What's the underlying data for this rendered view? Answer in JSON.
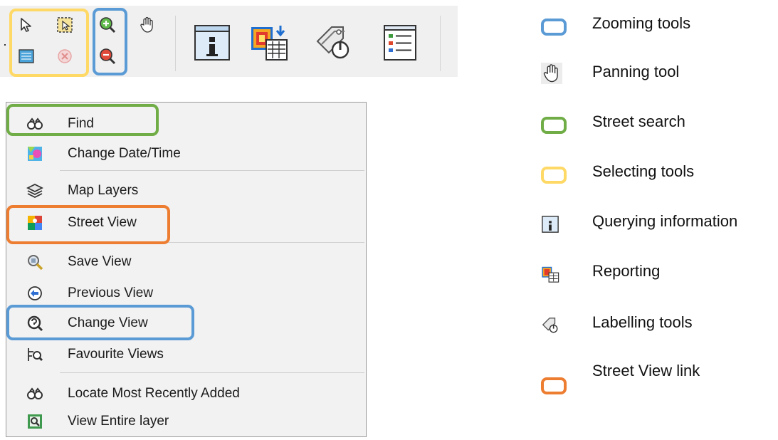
{
  "menu": {
    "items": [
      {
        "label": "Find",
        "icon": "binoculars-icon"
      },
      {
        "label": "Change Date/Time",
        "icon": "date-time-map-icon"
      },
      {
        "label": "Map Layers",
        "icon": "layers-icon"
      },
      {
        "label": "Street View",
        "icon": "street-view-icon"
      },
      {
        "label": "Save View",
        "icon": "magnifier-save-icon"
      },
      {
        "label": "Previous View",
        "icon": "back-arrow-circle-icon"
      },
      {
        "label": "Change View",
        "icon": "change-view-magnifier-icon"
      },
      {
        "label": "Favourite Views",
        "icon": "favourite-views-icon"
      },
      {
        "label": "Locate Most Recently Added",
        "icon": "binoculars-icon"
      },
      {
        "label": "View Entire layer",
        "icon": "view-entire-layer-icon"
      }
    ]
  },
  "legend": [
    {
      "label": "Zooming tools",
      "swatch_color": "#5b9bd5"
    },
    {
      "label": "Panning tool",
      "icon": "pan-hand-icon"
    },
    {
      "label": "Street search",
      "swatch_color": "#70ad47"
    },
    {
      "label": "Selecting tools",
      "swatch_color": "#ffd966"
    },
    {
      "label": "Querying information",
      "icon": "info-query-icon"
    },
    {
      "label": "Reporting",
      "icon": "report-icon"
    },
    {
      "label": "Labelling tools",
      "icon": "label-tag-icon"
    },
    {
      "label": "Street View link",
      "swatch_color": "#ed7d31"
    }
  ],
  "colors": {
    "zoom_highlight": "#5b9bd5",
    "select_highlight": "#ffd966",
    "search_highlight": "#70ad47",
    "streetview_highlight": "#ed7d31"
  }
}
